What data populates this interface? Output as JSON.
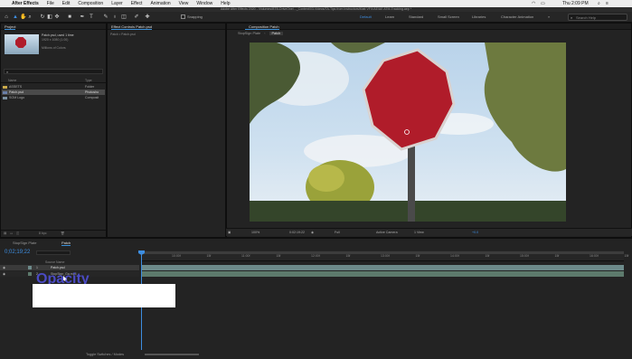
{
  "menubar": {
    "app": "After Effects",
    "items": [
      "File",
      "Edit",
      "Composition",
      "Layer",
      "Effect",
      "Animation",
      "View",
      "Window",
      "Help"
    ],
    "clock": "Thu 2:09 PM"
  },
  "title": "Adobe After Effects 2020 - /Volumes/BTB-DriveOne/..._Content/03-Videos/TA-Tips from Instructors/Matt VFX/AE/AE ATM-Tracking.aep *",
  "toolbar": {
    "snapping": "Snapping",
    "workspaces": [
      "Default",
      "Learn",
      "Standard",
      "Small Screen",
      "Libraries",
      "Character Animation"
    ],
    "search_placeholder": "Search Help"
  },
  "project": {
    "tab": "Project",
    "effect_tab": "Effect Controls Patch.psd",
    "effect_sub": "Patch • Patch.psd",
    "thumb_name": "Patch.psd",
    "thumb_used": ", used 1 time",
    "thumb_dims": "1920 x 1080 (1.00)",
    "thumb_colors": "Millions of Colors",
    "search_placeholder": "",
    "col_name": "Name",
    "col_type": "Type",
    "items": [
      {
        "name": "ASSETS",
        "type": "Folder",
        "selected": false
      },
      {
        "name": "Patch.psd",
        "type": "Photosho",
        "selected": true
      },
      {
        "name": "SOM Logo",
        "type": "Composit",
        "selected": false
      }
    ],
    "bpc": "8 bpc"
  },
  "composition": {
    "tab": "Composition Patch",
    "subtabs": [
      "StopSign Plate",
      "Patch"
    ],
    "zoom": "100%",
    "timecode": "0:02:19:22",
    "quality": "Full",
    "camera": "Active Camera",
    "view": "1 View",
    "offset": "+0.0"
  },
  "timeline": {
    "tabs": [
      "StopSign Plate",
      "Patch"
    ],
    "timecode": "0;02;19;22",
    "col_source": "Source Name",
    "ruler": [
      "10:00f",
      "15f",
      "11:00f",
      "15f",
      "12:00f",
      "15f",
      "13:00f",
      "15f",
      "14:00f",
      "15f",
      "15:00f",
      "15f",
      "16:00f",
      "15f"
    ],
    "layers": [
      {
        "index": "1",
        "name": "Patch.psd"
      },
      {
        "index": "2",
        "name": "StopSign_Ga.mp4"
      }
    ],
    "footer": "Toggle Switches / Modes"
  },
  "overlay_text": "Opacity",
  "colors": {
    "accent": "#3d8de0",
    "layer1": "#6d8a8a",
    "layer2": "#5d7a6c",
    "sign": "#b01c2a",
    "sky": "#a9cbe6"
  }
}
